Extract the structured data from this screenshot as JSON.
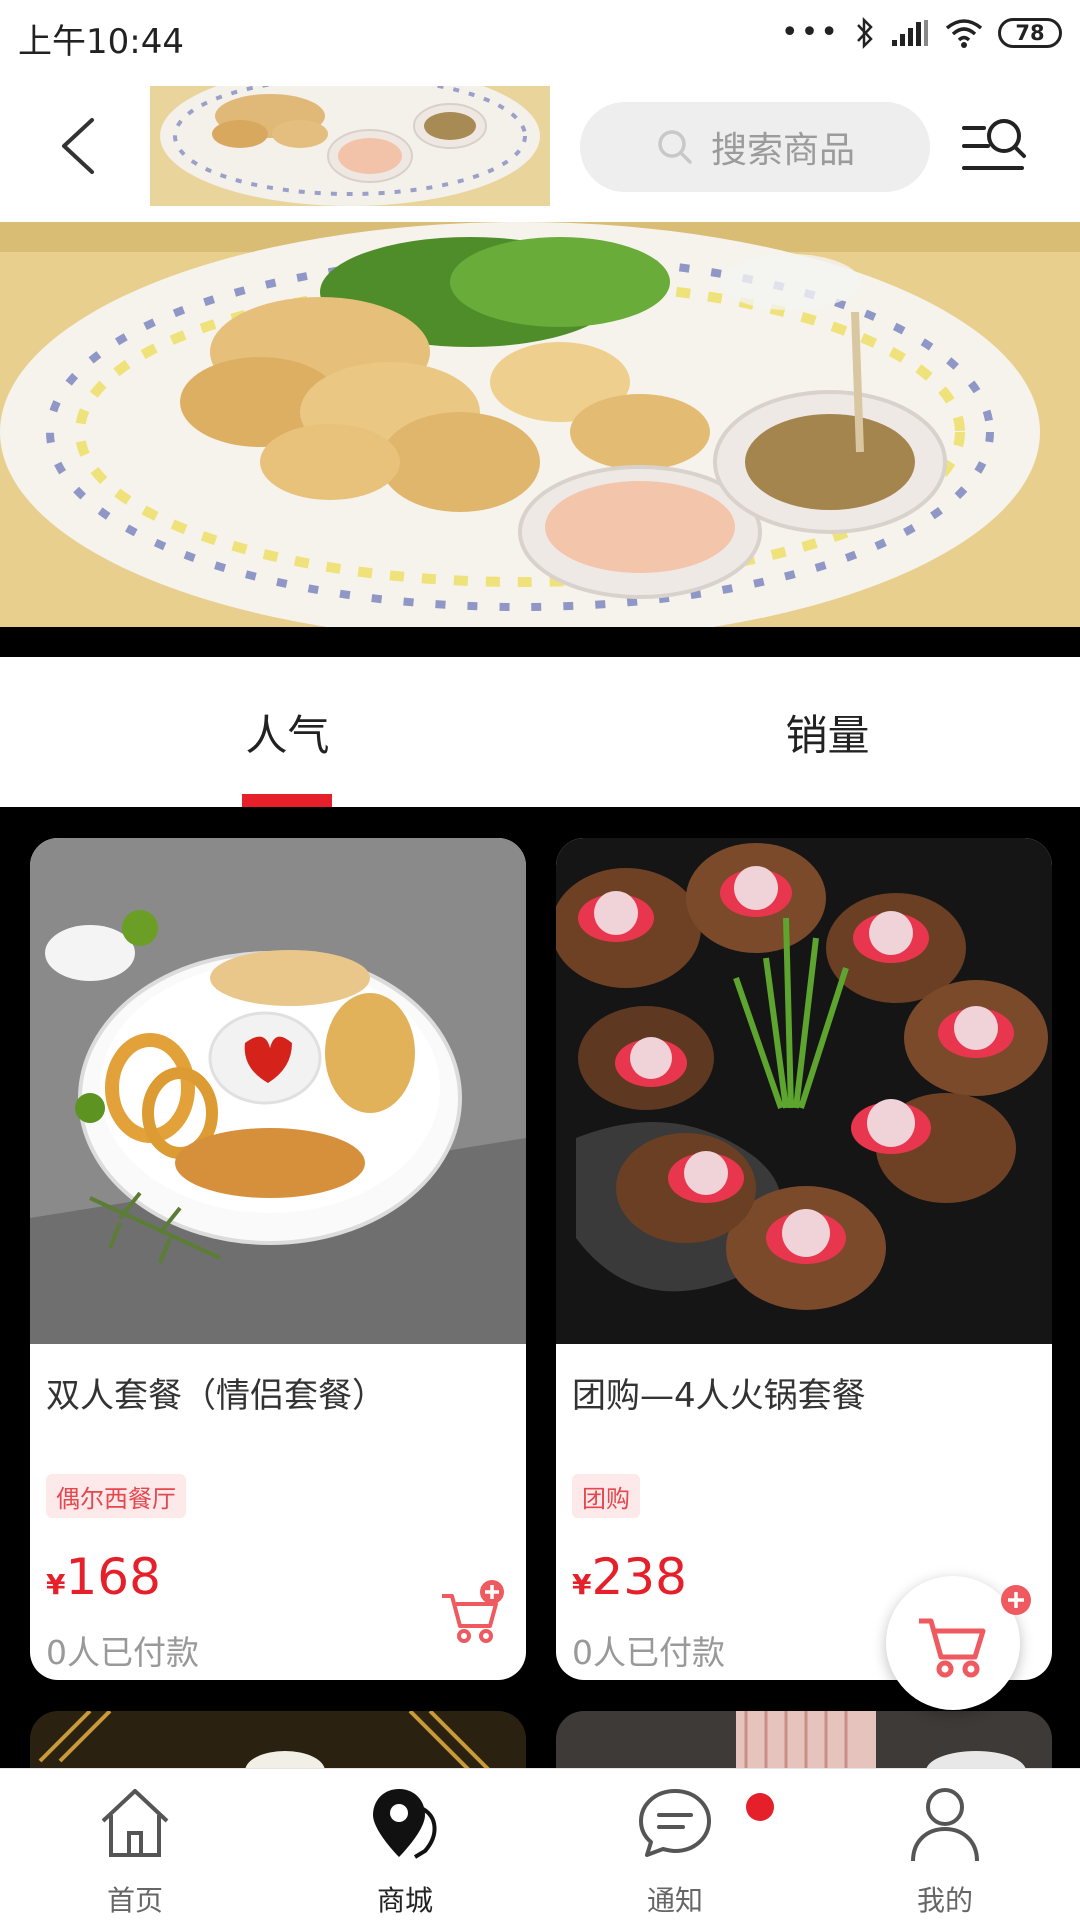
{
  "status_bar": {
    "time": "上午10:44",
    "battery": "78"
  },
  "header": {
    "search_placeholder": "搜索商品"
  },
  "tabs": [
    {
      "label": "人气",
      "active": true
    },
    {
      "label": "销量",
      "active": false
    }
  ],
  "products": [
    {
      "title": "双人套餐（情侣套餐）",
      "tag": "偶尔西餐厅",
      "currency": "¥",
      "price": "168",
      "paid": "0人已付款"
    },
    {
      "title": "团购—4人火锅套餐",
      "tag": "团购",
      "currency": "¥",
      "price": "238",
      "paid": "0人已付款"
    }
  ],
  "bottom_nav": [
    {
      "label": "首页",
      "icon": "home-icon"
    },
    {
      "label": "商城",
      "icon": "map-pin-icon",
      "active": true
    },
    {
      "label": "通知",
      "icon": "chat-bubble-icon",
      "has_badge": true
    },
    {
      "label": "我的",
      "icon": "user-icon"
    }
  ],
  "colors": {
    "accent": "#e5202a",
    "tag_bg": "#fde8ea",
    "muted_text": "#999999"
  }
}
